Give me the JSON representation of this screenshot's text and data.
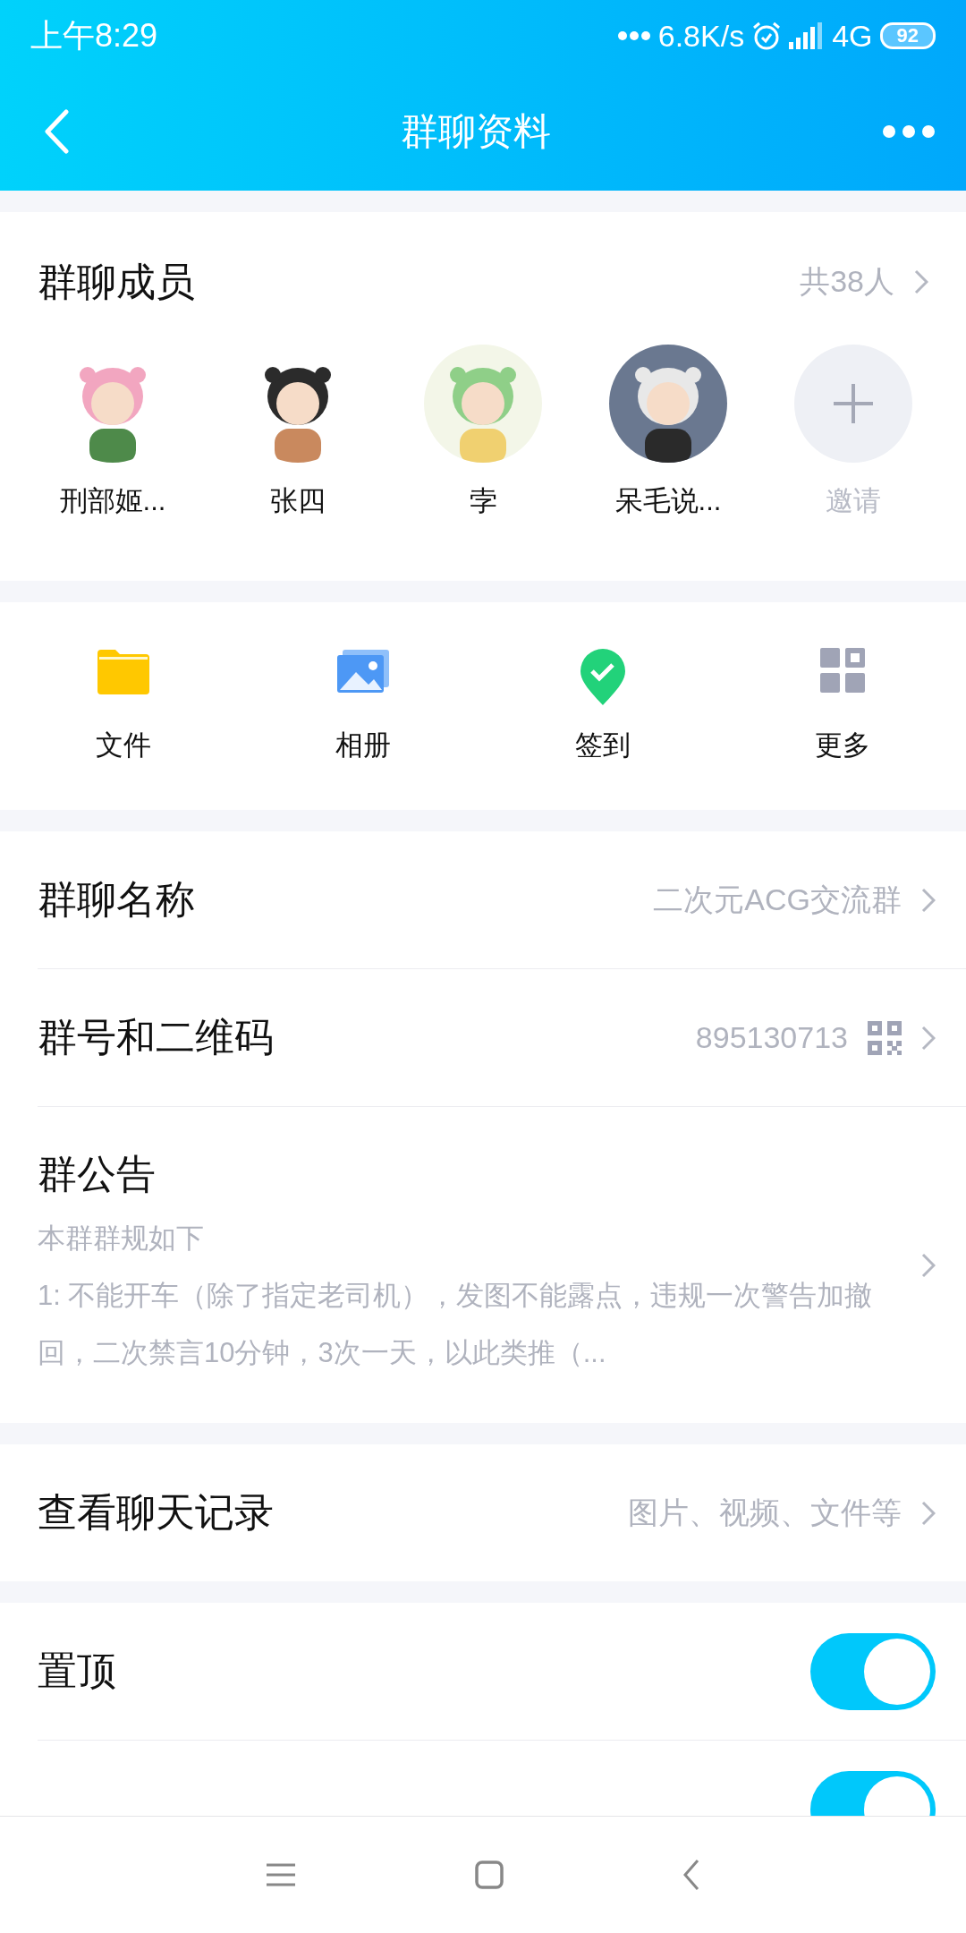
{
  "status_bar": {
    "time": "上午8:29",
    "network_speed": "6.8K/s",
    "network": "4G",
    "battery": "92"
  },
  "header": {
    "title": "群聊资料"
  },
  "members": {
    "title": "群聊成员",
    "count": "共38人",
    "items": [
      {
        "name": "刑部姬...",
        "kind": "member"
      },
      {
        "name": "张四",
        "kind": "member"
      },
      {
        "name": "孛",
        "kind": "member"
      },
      {
        "name": "呆毛说...",
        "kind": "member"
      },
      {
        "name": "邀请",
        "kind": "invite"
      }
    ]
  },
  "actions": [
    {
      "label": "文件",
      "kind": "folder"
    },
    {
      "label": "相册",
      "kind": "album"
    },
    {
      "label": "签到",
      "kind": "checkin"
    },
    {
      "label": "更多",
      "kind": "more"
    }
  ],
  "info_rows": [
    {
      "label": "群聊名称",
      "value": "二次元ACG交流群",
      "kind": "text"
    },
    {
      "label": "群号和二维码",
      "value": "895130713",
      "kind": "qr"
    }
  ],
  "announcement": {
    "title": "群公告",
    "lines": [
      "本群群规如下",
      "1: 不能开车（除了指定老司机），发图不能露点，违规一次警告加撤回，二次禁言10分钟，3次一天，以此类推（..."
    ]
  },
  "history": {
    "label": "查看聊天记录",
    "value": "图片、视频、文件等"
  },
  "toggles": [
    {
      "label": "置顶",
      "on": true
    },
    {
      "on": true
    }
  ]
}
